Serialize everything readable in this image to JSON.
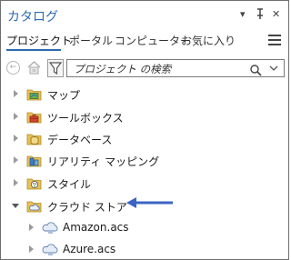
{
  "pane": {
    "title": "カタログ",
    "controls": {
      "dropdown": "▾",
      "pin": "ᅮ",
      "close": "✕"
    }
  },
  "tabs": [
    {
      "label": "プロジェクト",
      "active": true
    },
    {
      "label": "ポータル",
      "active": false
    },
    {
      "label": "コンピューター",
      "active": false
    },
    {
      "label": "お気に入り",
      "active": false
    }
  ],
  "toolbar": {
    "search_placeholder": "プロジェクト の検索"
  },
  "tree": [
    {
      "label": "マップ",
      "icon": "map-folder-icon",
      "expanded": false
    },
    {
      "label": "ツールボックス",
      "icon": "toolbox-folder-icon",
      "expanded": false
    },
    {
      "label": "データベース",
      "icon": "database-folder-icon",
      "expanded": false
    },
    {
      "label": "リアリティ マッピング",
      "icon": "reality-mapping-folder-icon",
      "expanded": false
    },
    {
      "label": "スタイル",
      "icon": "styles-folder-icon",
      "expanded": false
    },
    {
      "label": "クラウド ストア",
      "icon": "cloud-store-folder-icon",
      "expanded": true,
      "children": [
        {
          "label": "Amazon.acs",
          "icon": "cloud-connection-icon"
        },
        {
          "label": "Azure.acs",
          "icon": "cloud-connection-icon"
        }
      ]
    }
  ],
  "colors": {
    "accent": "#2c6ab1",
    "folder": "#e8c15a",
    "arrow": "#3d63c4"
  }
}
